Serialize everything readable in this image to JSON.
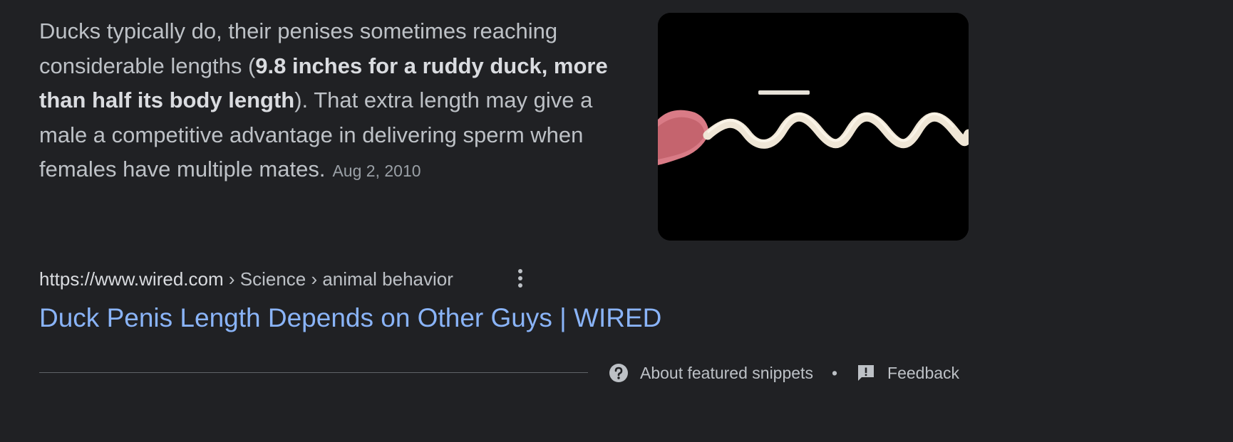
{
  "snippet": {
    "text_part1": "Ducks typically do, their penises sometimes reaching considerable lengths (",
    "bold": "9.8 inches for a ruddy duck, more than half its body length",
    "text_part2": "). That extra length may give a male a competitive advantage in delivering sperm when females have multiple mates.",
    "date": "Aug 2, 2010"
  },
  "result": {
    "url": "https://www.wired.com",
    "breadcrumb": " › Science › animal behavior",
    "title": "Duck Penis Length Depends on Other Guys | WIRED"
  },
  "footer": {
    "about_label": "About featured snippets",
    "separator": "•",
    "feedback_label": "Feedback"
  },
  "colors": {
    "background": "#202124",
    "text": "#bdc1c6",
    "link": "#8ab4f8",
    "divider": "#5f6368"
  },
  "icons": {
    "more": "more-vert-icon",
    "about": "help-circle-icon",
    "feedback": "feedback-icon"
  }
}
